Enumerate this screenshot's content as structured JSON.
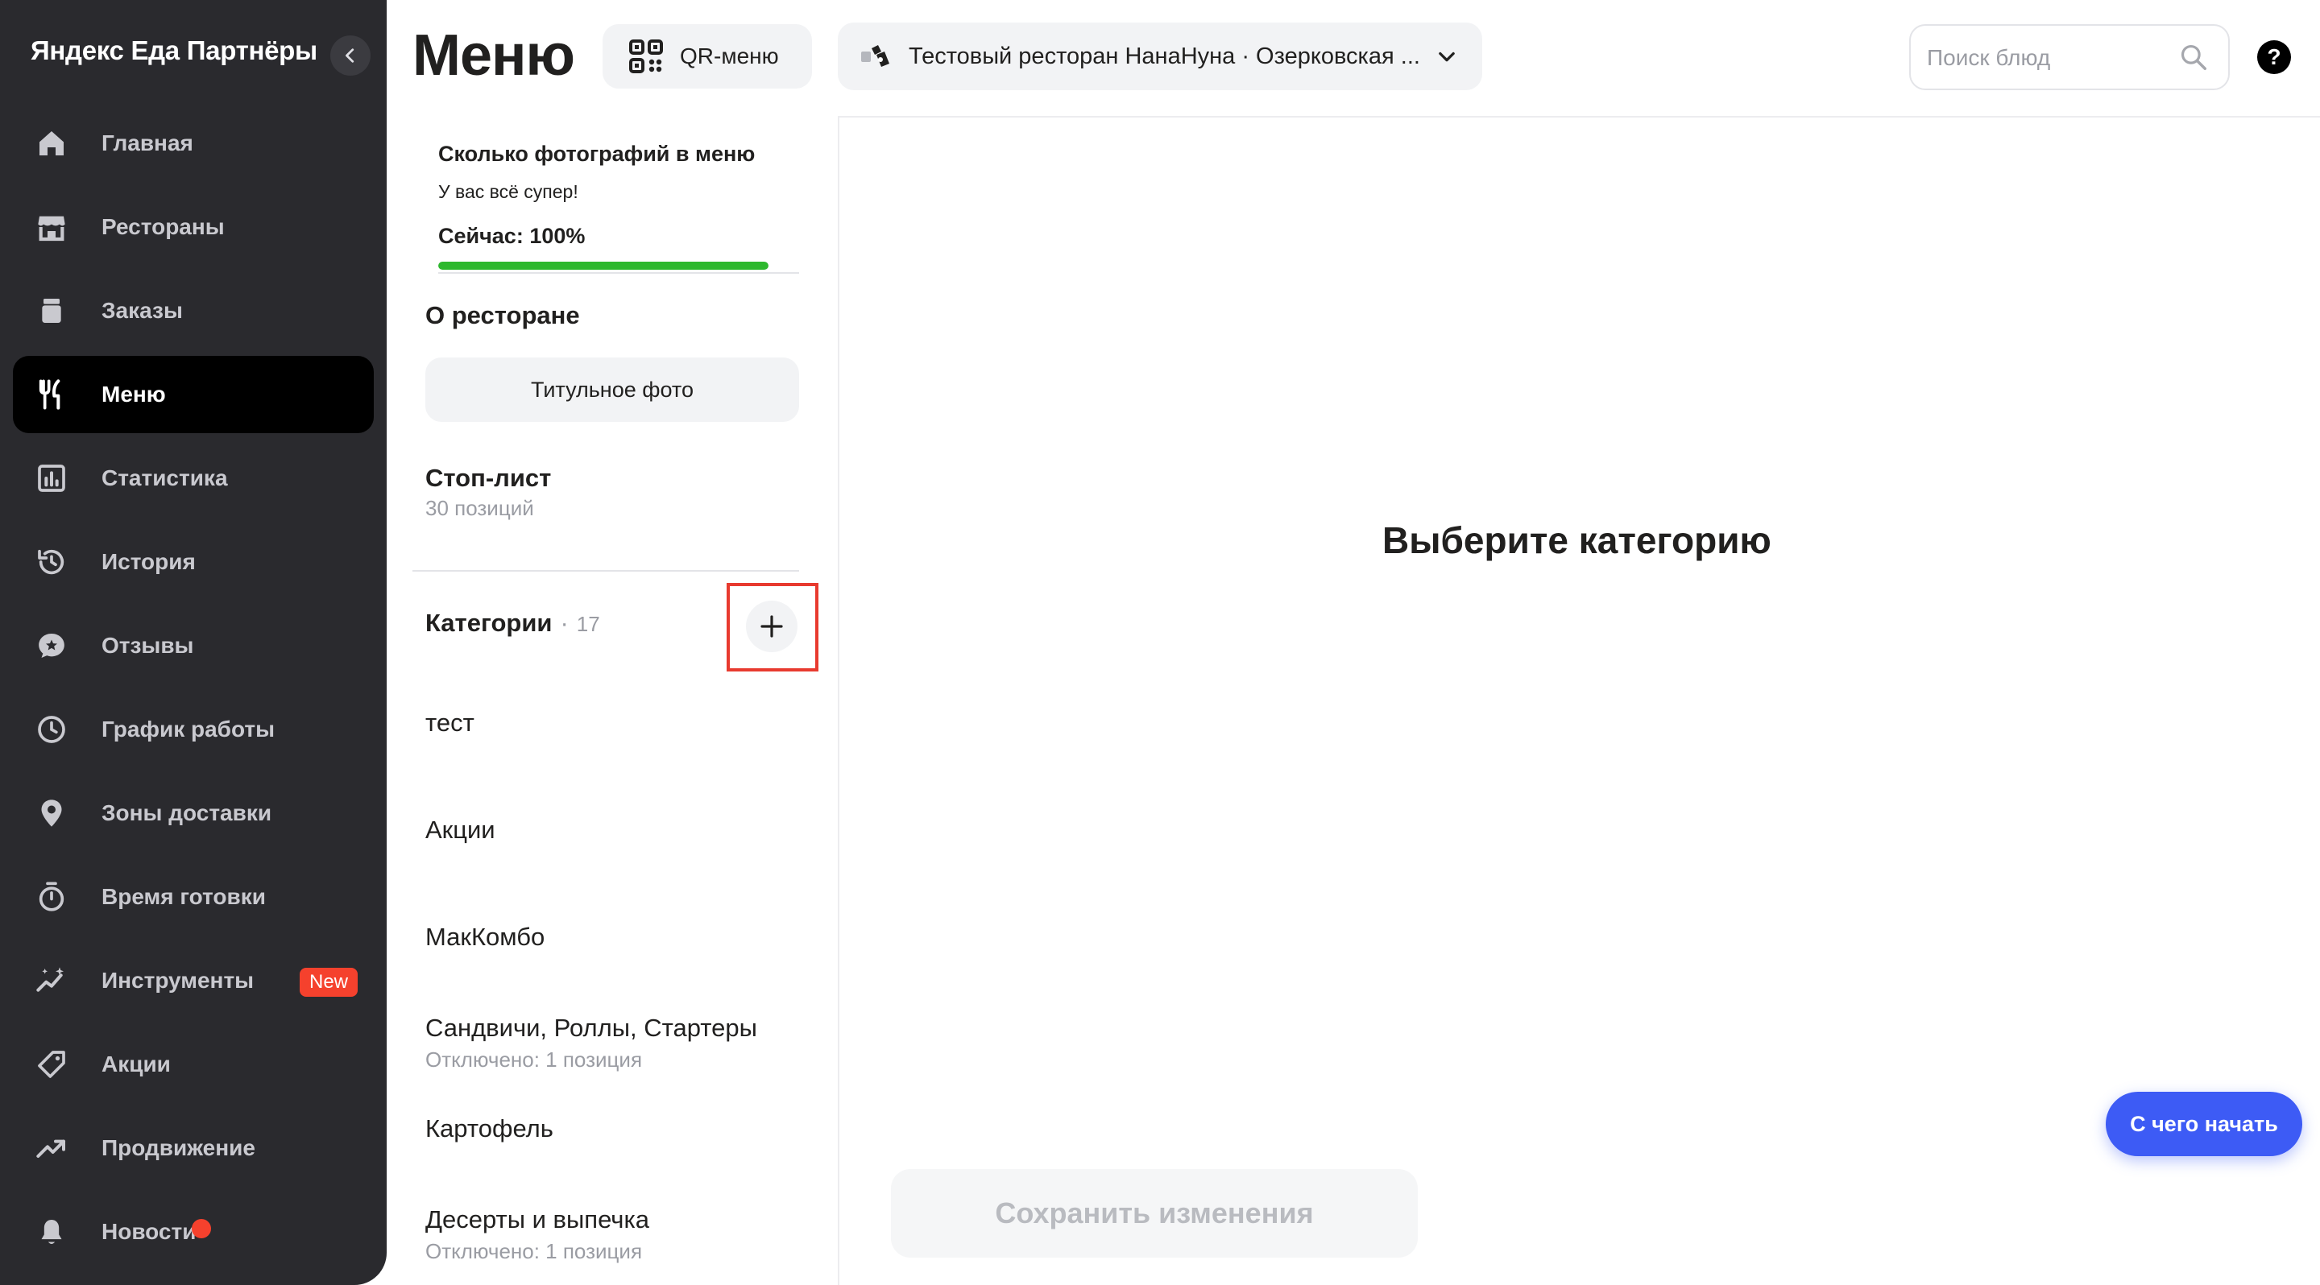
{
  "sidebar": {
    "brand": "Яндекс Еда Партнёры",
    "items": [
      {
        "label": "Главная",
        "icon": "home-icon"
      },
      {
        "label": "Рестораны",
        "icon": "store-icon"
      },
      {
        "label": "Заказы",
        "icon": "bag-icon"
      },
      {
        "label": "Меню",
        "icon": "fork-knife-icon",
        "active": true
      },
      {
        "label": "Статистика",
        "icon": "chart-icon"
      },
      {
        "label": "История",
        "icon": "history-icon"
      },
      {
        "label": "Отзывы",
        "icon": "star-chat-icon"
      },
      {
        "label": "График работы",
        "icon": "clock-icon"
      },
      {
        "label": "Зоны доставки",
        "icon": "pin-icon"
      },
      {
        "label": "Время готовки",
        "icon": "timer-icon"
      },
      {
        "label": "Инструменты",
        "icon": "sparkle-icon",
        "badge": "New"
      },
      {
        "label": "Акции",
        "icon": "tag-icon"
      },
      {
        "label": "Продвижение",
        "icon": "trend-icon"
      },
      {
        "label": "Новости",
        "icon": "bell-icon",
        "has_dot": true
      }
    ]
  },
  "header": {
    "title": "Меню",
    "qr_label": "QR-меню",
    "restaurant": "Тестовый ресторан НанаНуна · Озерковская ...",
    "search_placeholder": "Поиск блюд",
    "help": "?"
  },
  "photos": {
    "title": "Сколько фотографий в меню",
    "subtitle": "У вас всё супер!",
    "now": "Сейчас: 100%",
    "progress_percent": 100
  },
  "about": {
    "title": "О ресторане",
    "cover_button": "Титульное фото"
  },
  "stoplist": {
    "title": "Стоп-лист",
    "count": "30 позиций"
  },
  "categories": {
    "label": "Категории",
    "separator": "·",
    "count": "17",
    "items": [
      {
        "name": "тест",
        "note": ""
      },
      {
        "name": "Акции",
        "note": ""
      },
      {
        "name": "МакКомбо",
        "note": ""
      },
      {
        "name": "Сандвичи, Роллы, Стартеры",
        "note": "Отключено: 1 позиция"
      },
      {
        "name": "Картофель",
        "note": ""
      },
      {
        "name": "Десерты и выпечка",
        "note": "Отключено: 1 позиция"
      }
    ]
  },
  "main": {
    "empty_title": "Выберите категорию",
    "save_button": "Сохранить изменения",
    "start_button": "С чего начать"
  },
  "colors": {
    "sidebar_bg": "#2a2a2e",
    "active_item_bg": "#000000",
    "badge": "#f5412d",
    "progress": "#2eb82e",
    "highlight": "#e83a2f",
    "primary": "#3d5bf5"
  }
}
